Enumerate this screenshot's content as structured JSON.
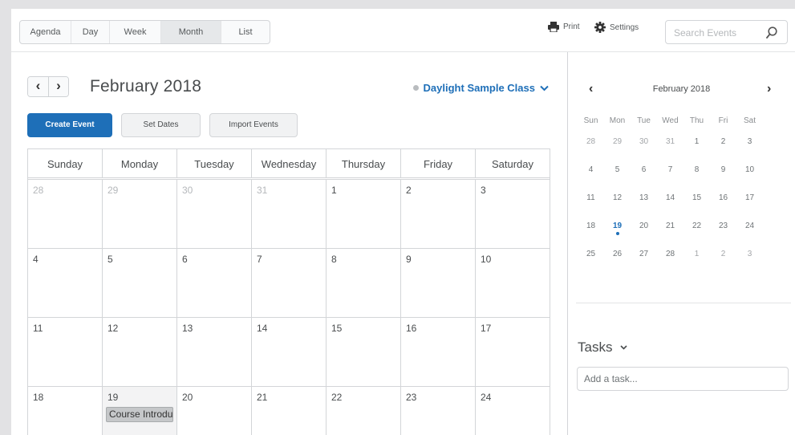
{
  "views": [
    "Agenda",
    "Day",
    "Week",
    "Month",
    "List"
  ],
  "active_view": "Month",
  "toolbar": {
    "print_label": "Print",
    "settings_label": "Settings",
    "search_placeholder": "Search Events"
  },
  "calendar": {
    "title": "February 2018",
    "prev_label": "‹",
    "next_label": "›",
    "class_name": "Daylight Sample Class",
    "actions": {
      "create": "Create Event",
      "set_dates": "Set Dates",
      "import": "Import Events"
    },
    "weekdays": [
      "Sunday",
      "Monday",
      "Tuesday",
      "Wednesday",
      "Thursday",
      "Friday",
      "Saturday"
    ],
    "weeks": [
      [
        "28",
        "29",
        "30",
        "31",
        "1",
        "2",
        "3"
      ],
      [
        "4",
        "5",
        "6",
        "7",
        "8",
        "9",
        "10"
      ],
      [
        "11",
        "12",
        "13",
        "14",
        "15",
        "16",
        "17"
      ],
      [
        "18",
        "19",
        "20",
        "21",
        "22",
        "23",
        "24"
      ]
    ],
    "event": {
      "title": "Course Introdu"
    }
  },
  "mini_calendar": {
    "title": "February 2018",
    "prev_label": "‹",
    "next_label": "›",
    "dow": [
      "Sun",
      "Mon",
      "Tue",
      "Wed",
      "Thu",
      "Fri",
      "Sat"
    ],
    "weeks": [
      [
        "28",
        "29",
        "30",
        "31",
        "1",
        "2",
        "3"
      ],
      [
        "4",
        "5",
        "6",
        "7",
        "8",
        "9",
        "10"
      ],
      [
        "11",
        "12",
        "13",
        "14",
        "15",
        "16",
        "17"
      ],
      [
        "18",
        "19",
        "20",
        "21",
        "22",
        "23",
        "24"
      ],
      [
        "25",
        "26",
        "27",
        "28",
        "1",
        "2",
        "3"
      ]
    ]
  },
  "tasks": {
    "title": "Tasks",
    "chevron": "⌄",
    "placeholder": "Add a task..."
  }
}
